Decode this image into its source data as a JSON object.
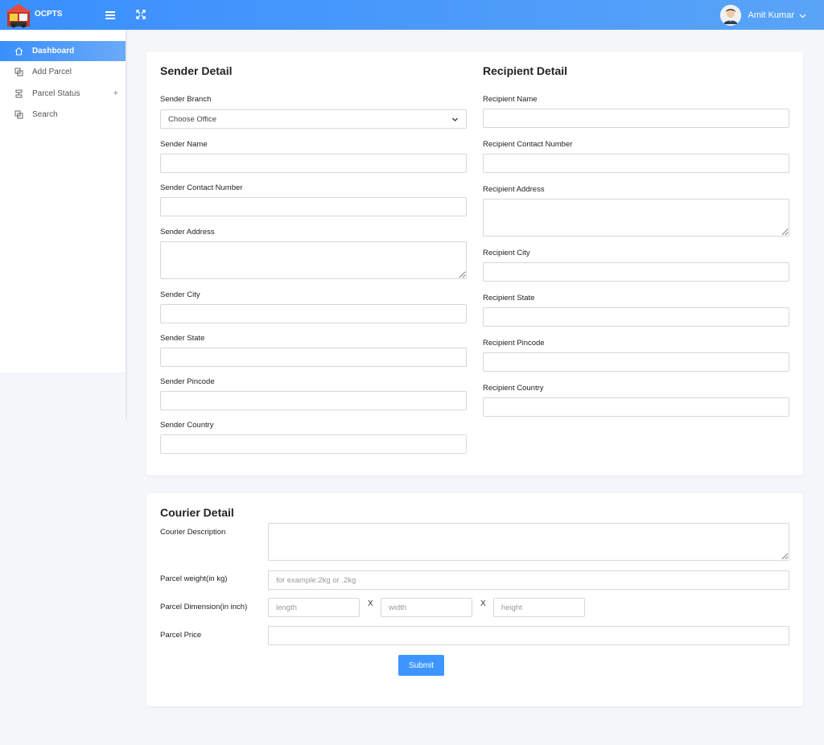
{
  "header": {
    "brand": "OCPTS",
    "user_name": "Amit Kumar"
  },
  "sidebar": {
    "items": [
      {
        "label": "Dashboard"
      },
      {
        "label": "Add Parcel"
      },
      {
        "label": "Parcel Status"
      },
      {
        "label": "Search"
      }
    ]
  },
  "sender": {
    "title": "Sender Detail",
    "branch_label": "Sender Branch",
    "branch_value": "Choose Office",
    "name_label": "Sender Name",
    "contact_label": "Sender Contact Number",
    "address_label": "Sender Address",
    "city_label": "Sender City",
    "state_label": "Sender State",
    "pincode_label": "Sender Pincode",
    "country_label": "Sender Country"
  },
  "recipient": {
    "title": "Recipient Detail",
    "name_label": "Recipient Name",
    "contact_label": "Recipient Contact Number",
    "address_label": "Recipient Address",
    "city_label": "Recipient City",
    "state_label": "Recipient State",
    "pincode_label": "Recipient Pincode",
    "country_label": "Recipient Country"
  },
  "courier": {
    "title": "Courier Detail",
    "description_label": "Courier Description",
    "weight_label": "Parcel weight(in kg)",
    "weight_placeholder": "for example:2kg or .2kg",
    "dimension_label": "Parcel Dimension(in inch)",
    "length_placeholder": "length",
    "width_placeholder": "width",
    "height_placeholder": "height",
    "x_separator": "X",
    "price_label": "Parcel Price",
    "submit_label": "Submit"
  },
  "colors": {
    "accent": "#3a8fff",
    "button": "#3d96ff"
  }
}
